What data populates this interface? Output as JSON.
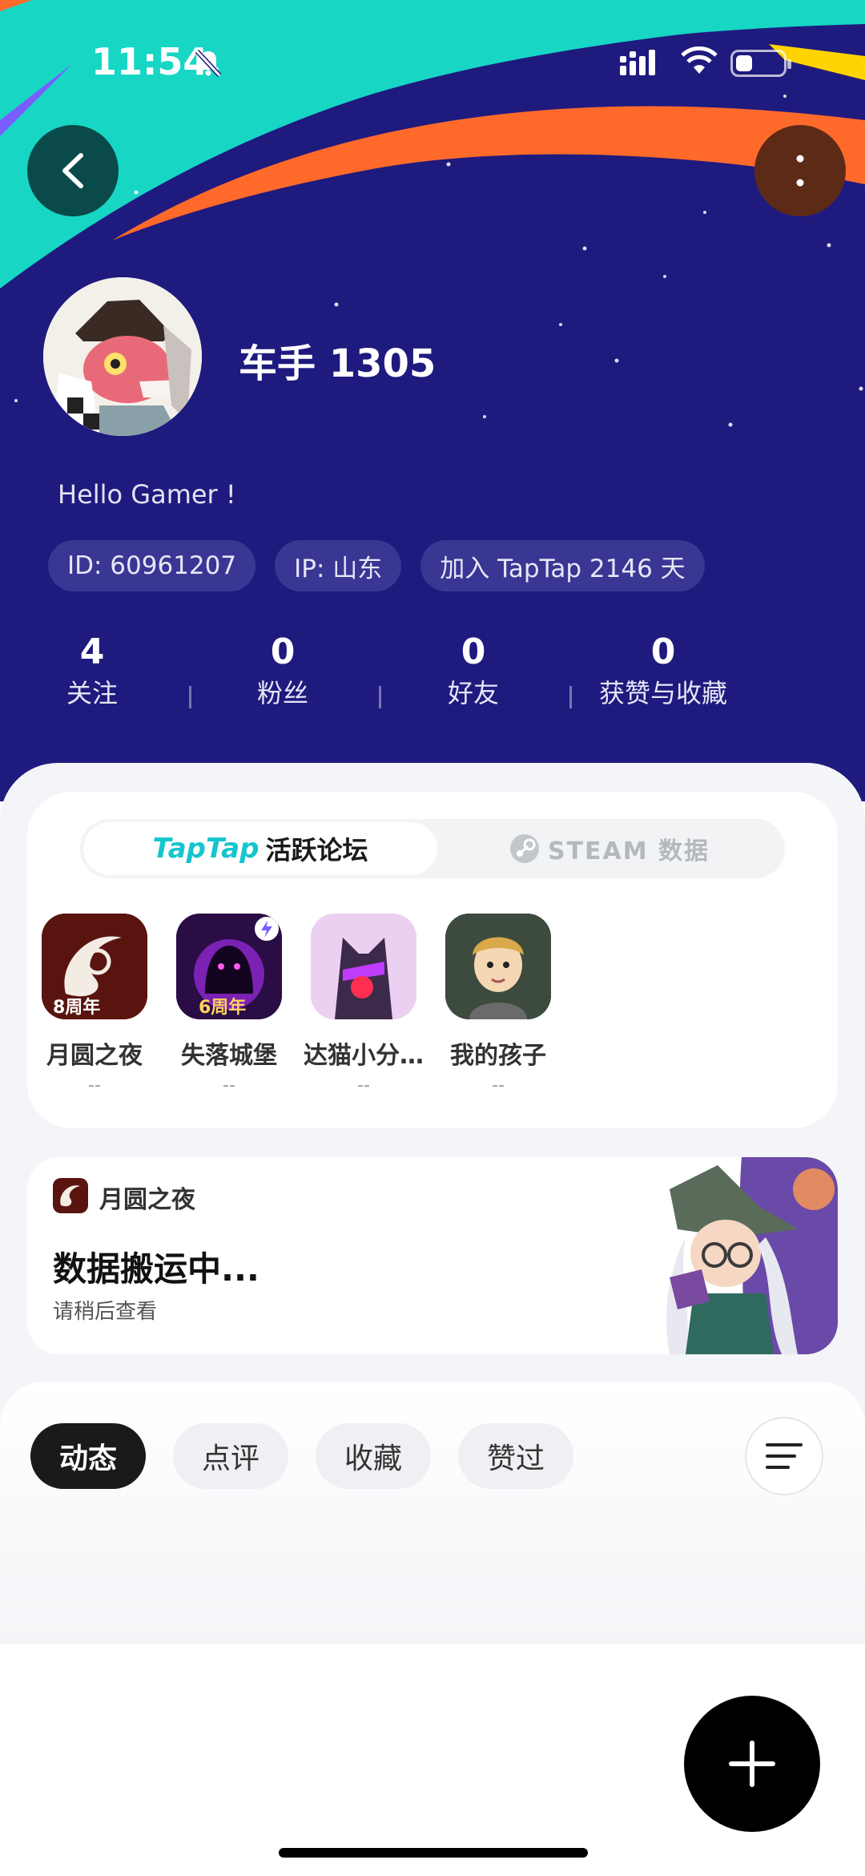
{
  "status_bar": {
    "time": "11:54"
  },
  "profile": {
    "username": "车手 1305",
    "bio": "Hello Gamer !",
    "chips": [
      "ID: 60961207",
      "IP: 山东",
      "加入 TapTap 2146 天"
    ]
  },
  "stats": [
    {
      "value": "4",
      "label": "关注"
    },
    {
      "value": "0",
      "label": "粉丝"
    },
    {
      "value": "0",
      "label": "好友"
    },
    {
      "value": "0",
      "label": "获赞与收藏"
    }
  ],
  "segment": {
    "active_logo": "TapTap",
    "active_label": "活跃论坛",
    "inactive_label": "STEAM 数据"
  },
  "games": [
    {
      "name": "月圆之夜",
      "sub": "--",
      "badge": "8周年"
    },
    {
      "name": "失落城堡",
      "sub": "--",
      "badge": "6周年"
    },
    {
      "name": "达猫小分…",
      "sub": "--"
    },
    {
      "name": "我的孩子",
      "sub": "--"
    }
  ],
  "promo": {
    "game": "月圆之夜",
    "title": "数据搬运中...",
    "subtitle": "请稍后查看"
  },
  "feed_tabs": [
    "动态",
    "点评",
    "收藏",
    "赞过"
  ],
  "colors": {
    "header_bg": "#1f1a7e",
    "teal_stripe": "#17d6c4",
    "orange_stripe": "#ff6a2b",
    "taptap_brand": "#15c5ce"
  }
}
